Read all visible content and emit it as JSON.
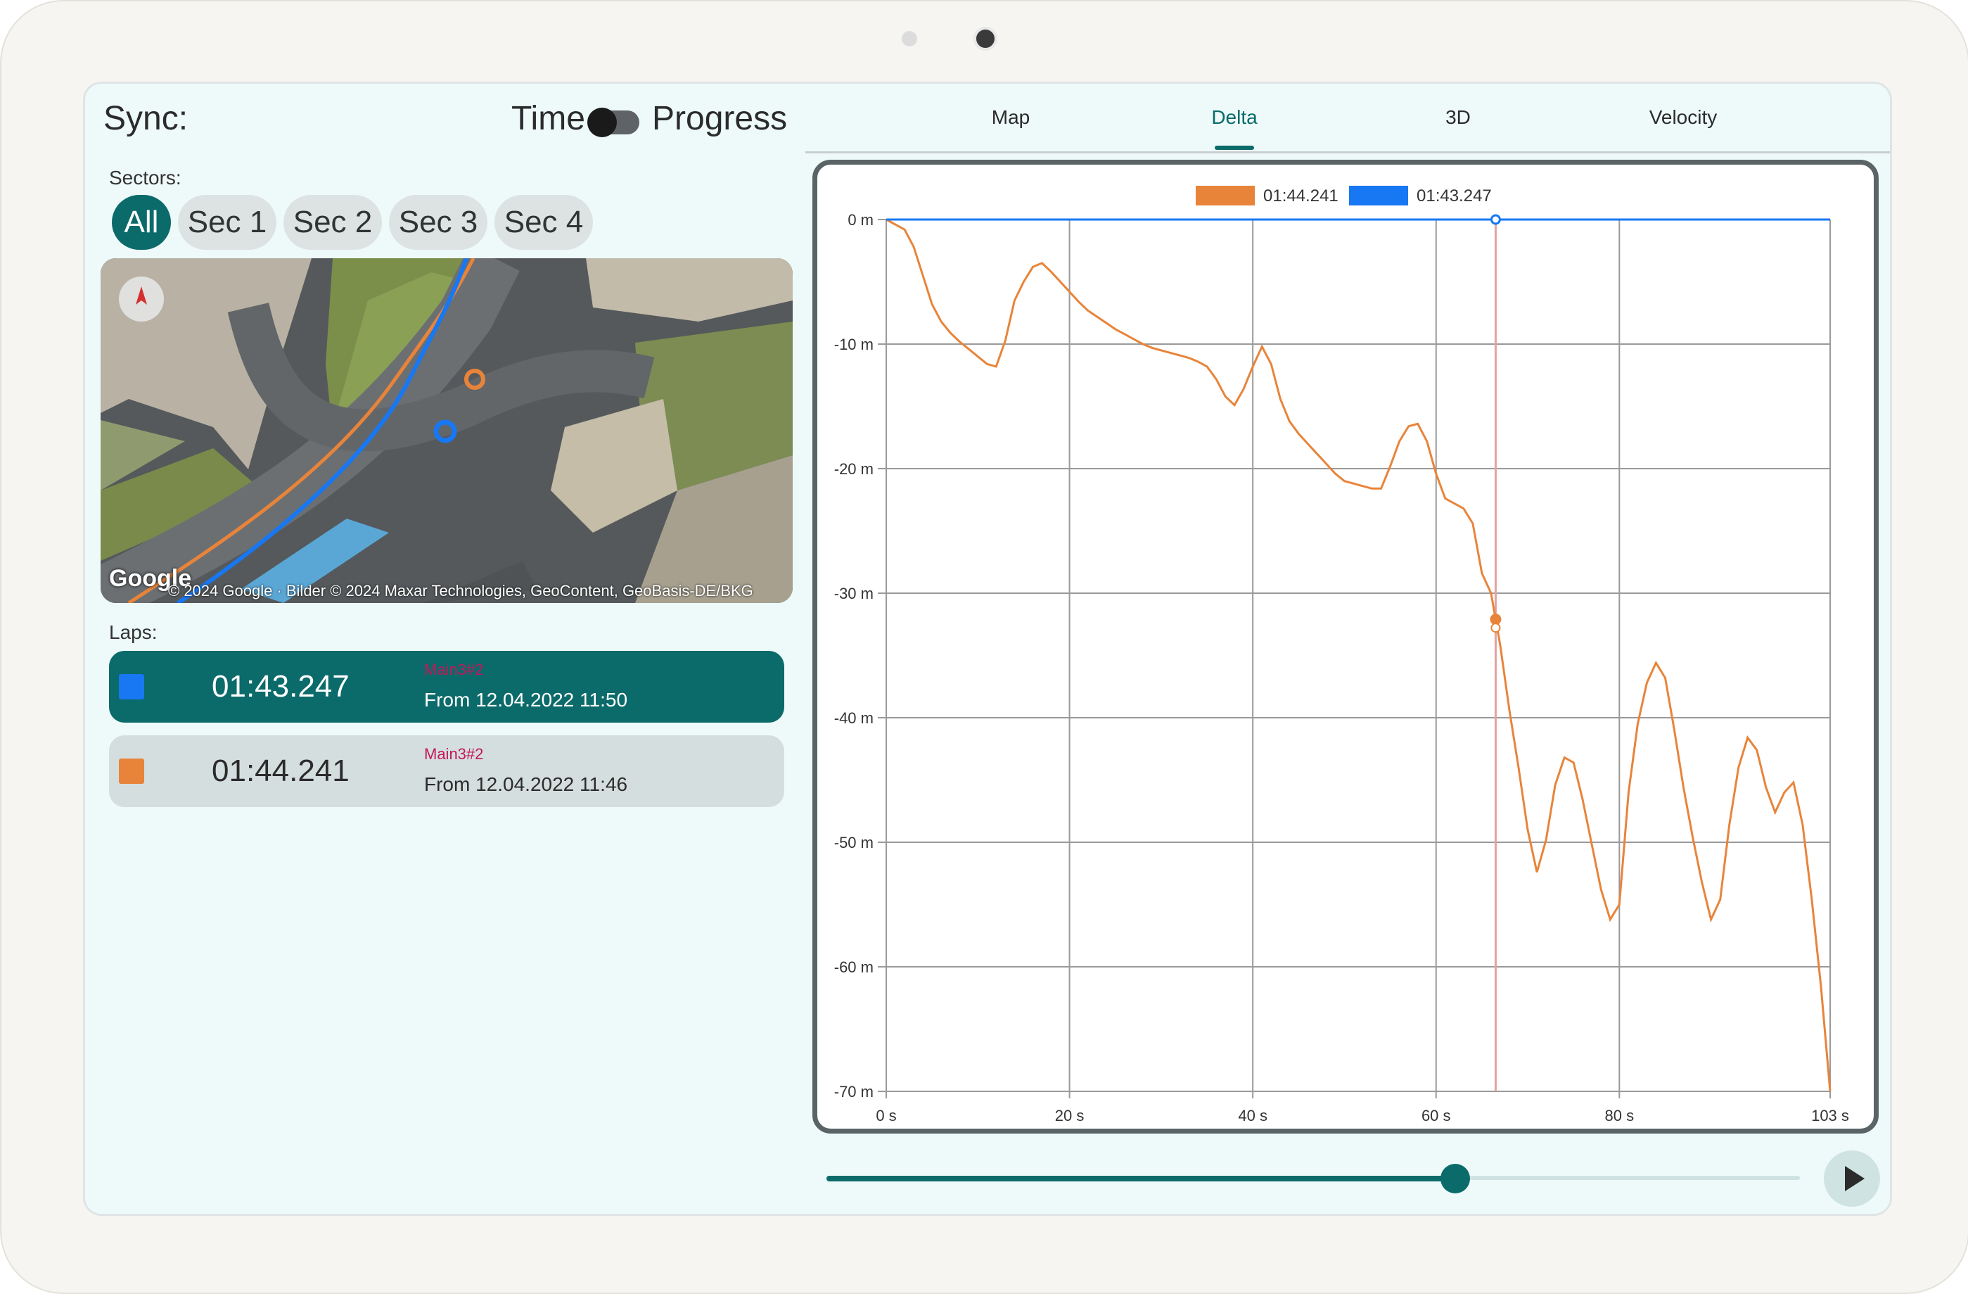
{
  "header": {
    "sync_label": "Sync:",
    "time_label": "Time",
    "progress_label": "Progress",
    "sync_mode": "Time"
  },
  "sectors": {
    "label": "Sectors:",
    "items": [
      "All",
      "Sec 1",
      "Sec 2",
      "Sec 3",
      "Sec 4"
    ],
    "selected": "All"
  },
  "map": {
    "google_logo": "Google",
    "attribution": "© 2024 Google · Bilder © 2024 Maxar Technologies, GeoContent, GeoBasis-DE/BKG"
  },
  "laps": {
    "label": "Laps:",
    "items": [
      {
        "time": "01:43.247",
        "tag": "Main3#2",
        "from": "From 12.04.2022 11:50",
        "color": "#1877f2",
        "selected": true
      },
      {
        "time": "01:44.241",
        "tag": "Main3#2",
        "from": "From 12.04.2022 11:46",
        "color": "#e8843a",
        "selected": false
      }
    ]
  },
  "tabs": {
    "items": [
      "Map",
      "Delta",
      "3D",
      "Velocity"
    ],
    "active": "Delta"
  },
  "chart_data": {
    "type": "line",
    "legend_placement": "top-center",
    "grid": true,
    "xlim": [
      0,
      103
    ],
    "ylim": [
      -70,
      0
    ],
    "x_ticks": [
      0,
      20,
      40,
      60,
      80,
      103
    ],
    "x_tick_labels": [
      "0 s",
      "20 s",
      "40 s",
      "60 s",
      "80 s",
      "103 s"
    ],
    "y_ticks": [
      0,
      -10,
      -20,
      -30,
      -40,
      -50,
      -60,
      -70
    ],
    "y_tick_labels": [
      "0 m",
      "-10 m",
      "-20 m",
      "-30 m",
      "-40 m",
      "-50 m",
      "-60 m",
      "-70 m"
    ],
    "cursor_x": 66.5,
    "series": [
      {
        "name": "01:44.241",
        "color": "#e8843a",
        "points": [
          [
            0,
            0
          ],
          [
            1,
            -0.4
          ],
          [
            2,
            -0.8
          ],
          [
            3,
            -2.2
          ],
          [
            4,
            -4.5
          ],
          [
            5,
            -6.8
          ],
          [
            6,
            -8.2
          ],
          [
            7,
            -9.1
          ],
          [
            8,
            -9.8
          ],
          [
            9,
            -10.4
          ],
          [
            10,
            -11
          ],
          [
            11,
            -11.6
          ],
          [
            12,
            -11.8
          ],
          [
            13,
            -9.7
          ],
          [
            14,
            -6.5
          ],
          [
            15,
            -5
          ],
          [
            16,
            -3.8
          ],
          [
            17,
            -3.5
          ],
          [
            18,
            -4.2
          ],
          [
            19,
            -5
          ],
          [
            20,
            -5.8
          ],
          [
            21,
            -6.6
          ],
          [
            22,
            -7.3
          ],
          [
            23,
            -7.8
          ],
          [
            24,
            -8.3
          ],
          [
            25,
            -8.8
          ],
          [
            26,
            -9.2
          ],
          [
            27,
            -9.6
          ],
          [
            28,
            -10
          ],
          [
            29,
            -10.3
          ],
          [
            30,
            -10.5
          ],
          [
            31,
            -10.7
          ],
          [
            32,
            -10.9
          ],
          [
            33,
            -11.1
          ],
          [
            34,
            -11.4
          ],
          [
            35,
            -11.8
          ],
          [
            36,
            -12.8
          ],
          [
            37,
            -14.2
          ],
          [
            38,
            -14.9
          ],
          [
            39,
            -13.6
          ],
          [
            40,
            -11.8
          ],
          [
            41,
            -10.2
          ],
          [
            42,
            -11.6
          ],
          [
            43,
            -14.4
          ],
          [
            44,
            -16.2
          ],
          [
            45,
            -17.2
          ],
          [
            46,
            -18
          ],
          [
            47,
            -18.8
          ],
          [
            48,
            -19.6
          ],
          [
            49,
            -20.4
          ],
          [
            50,
            -21
          ],
          [
            51,
            -21.2
          ],
          [
            52,
            -21.4
          ],
          [
            53,
            -21.6
          ],
          [
            54,
            -21.6
          ],
          [
            55,
            -19.8
          ],
          [
            56,
            -17.8
          ],
          [
            57,
            -16.6
          ],
          [
            58,
            -16.4
          ],
          [
            59,
            -17.8
          ],
          [
            60,
            -20.4
          ],
          [
            61,
            -22.4
          ],
          [
            62,
            -22.8
          ],
          [
            63,
            -23.2
          ],
          [
            64,
            -24.4
          ],
          [
            65,
            -28.4
          ],
          [
            66,
            -30
          ],
          [
            67,
            -34.2
          ],
          [
            68,
            -39.4
          ],
          [
            69,
            -44
          ],
          [
            70,
            -49
          ],
          [
            71,
            -52.4
          ],
          [
            72,
            -49.8
          ],
          [
            73,
            -45.4
          ],
          [
            74,
            -43.2
          ],
          [
            75,
            -43.6
          ],
          [
            76,
            -46.6
          ],
          [
            77,
            -50.2
          ],
          [
            78,
            -53.8
          ],
          [
            79,
            -56.2
          ],
          [
            80,
            -55
          ],
          [
            81,
            -46
          ],
          [
            82,
            -40.5
          ],
          [
            83,
            -37.2
          ],
          [
            84,
            -35.6
          ],
          [
            85,
            -36.8
          ],
          [
            86,
            -41
          ],
          [
            87,
            -45.6
          ],
          [
            88,
            -49.6
          ],
          [
            89,
            -53.2
          ],
          [
            90,
            -56.2
          ],
          [
            91,
            -54.6
          ],
          [
            92,
            -48.6
          ],
          [
            93,
            -44
          ],
          [
            94,
            -41.6
          ],
          [
            95,
            -42.6
          ],
          [
            96,
            -45.6
          ],
          [
            97,
            -47.6
          ],
          [
            98,
            -46
          ],
          [
            99,
            -45.2
          ],
          [
            100,
            -48.6
          ],
          [
            101,
            -54.6
          ],
          [
            102,
            -61.6
          ],
          [
            103,
            -70
          ]
        ]
      },
      {
        "name": "01:43.247",
        "color": "#1877f2",
        "points": [
          [
            0,
            0
          ],
          [
            103,
            0
          ]
        ]
      }
    ]
  }
}
